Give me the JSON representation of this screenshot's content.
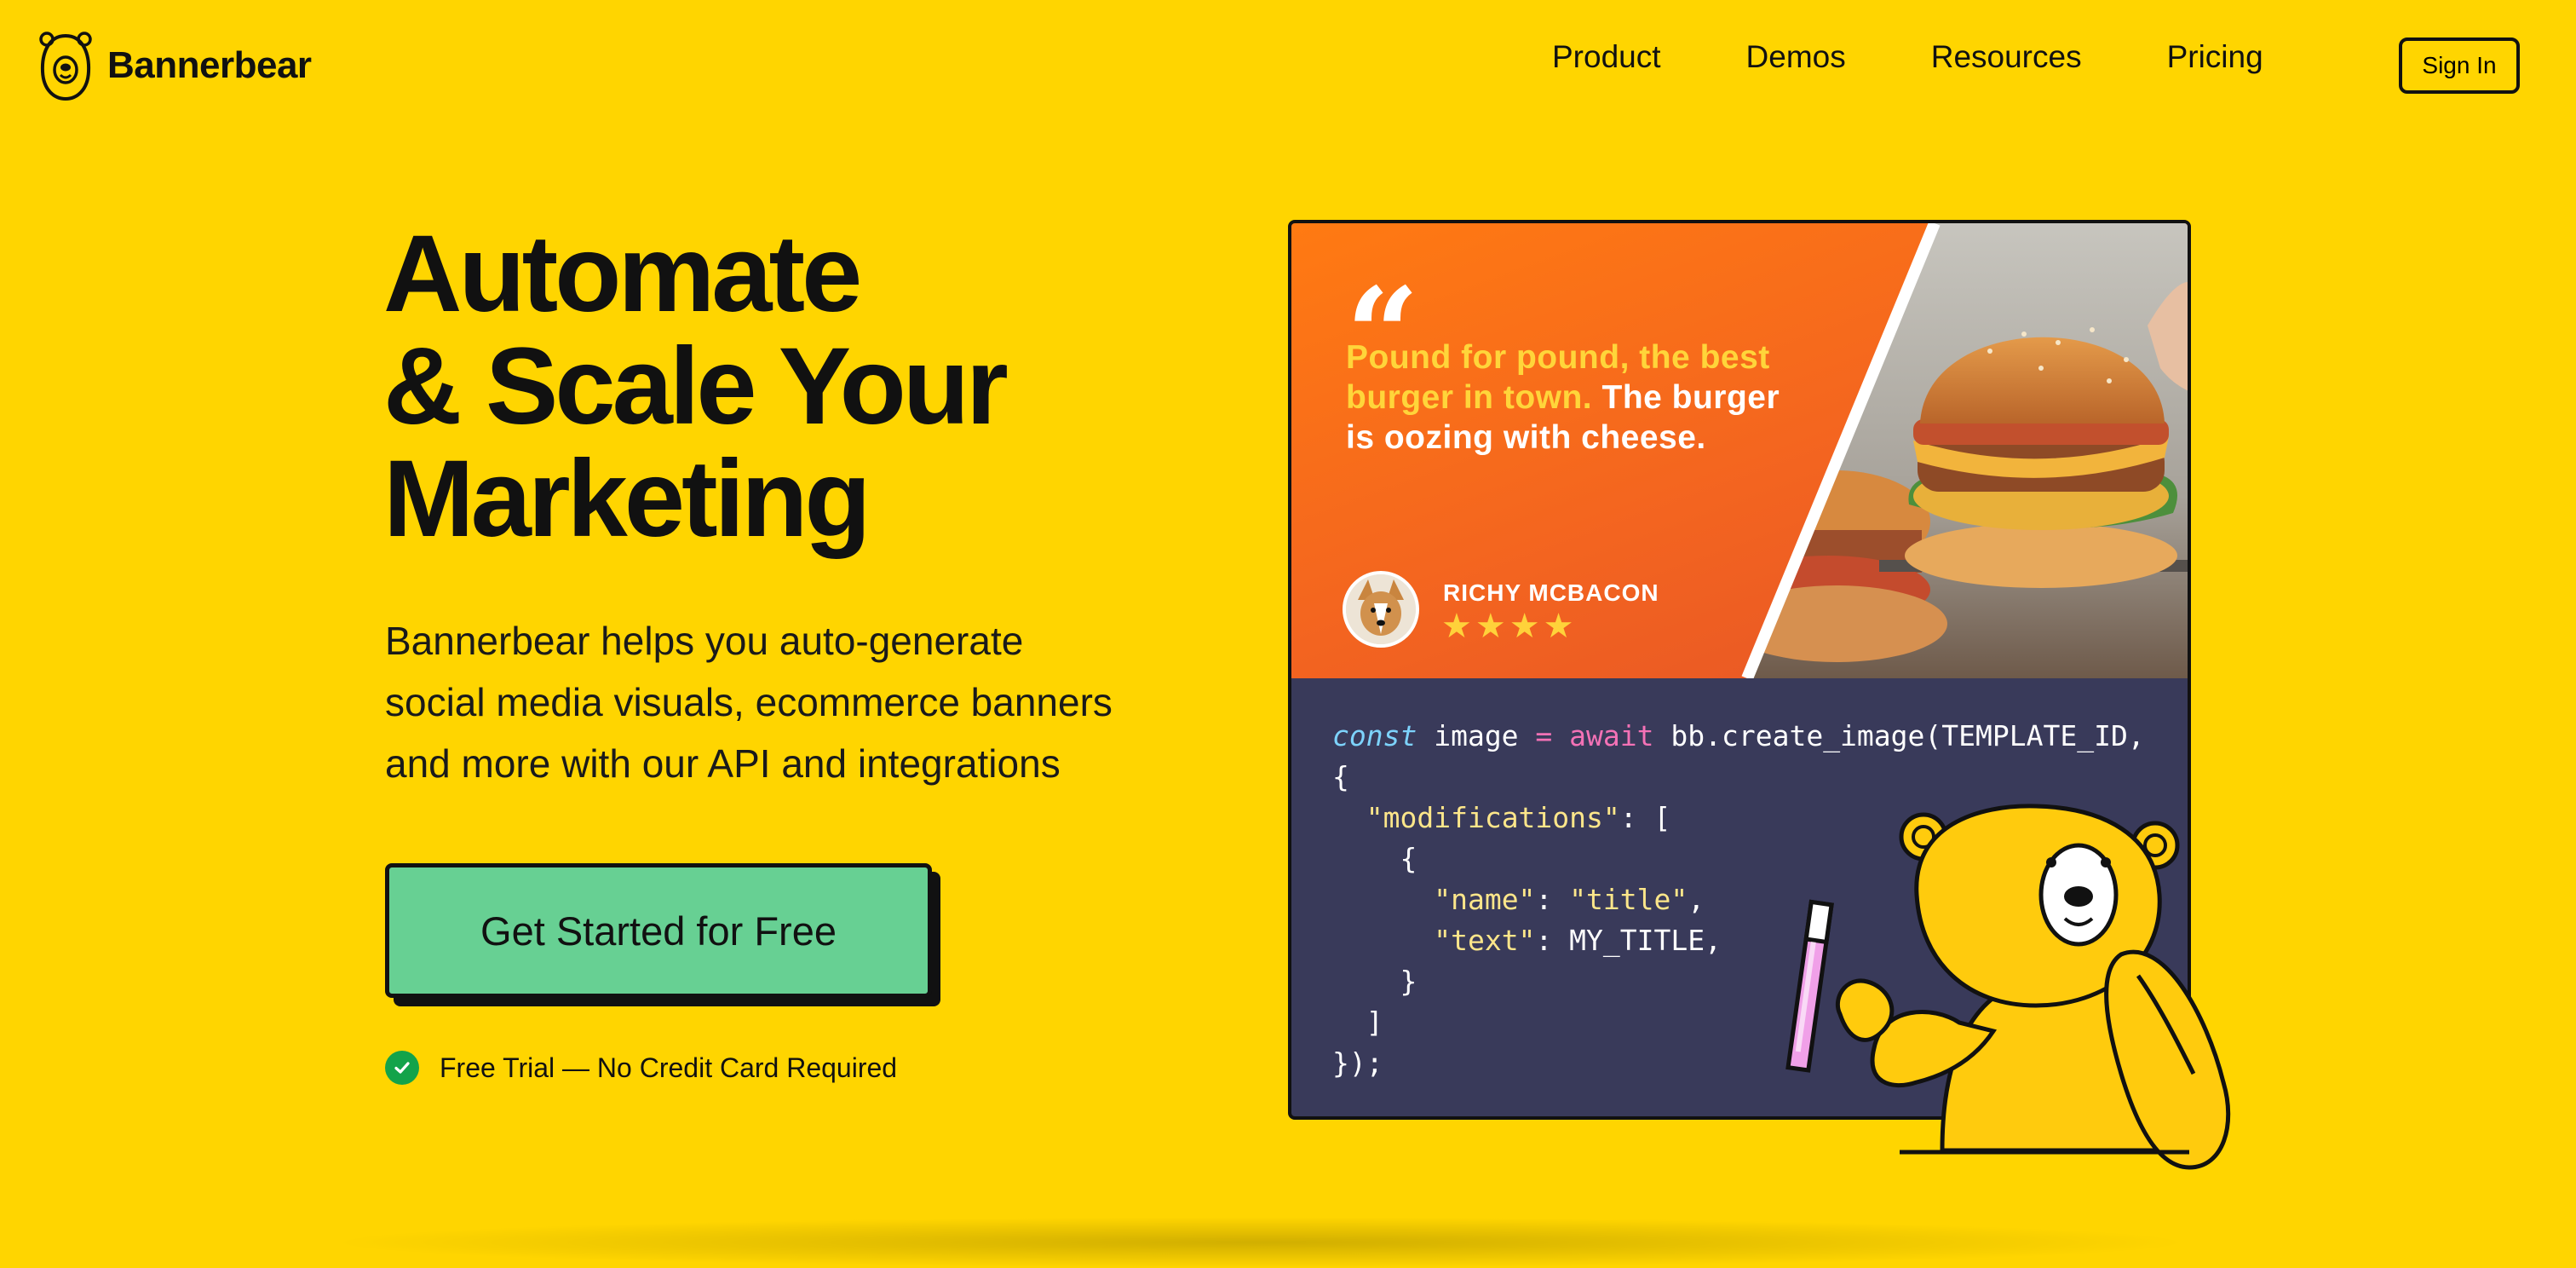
{
  "brand": {
    "name": "Bannerbear",
    "logo_icon": "bear-head-icon"
  },
  "nav": {
    "items": [
      "Product",
      "Demos",
      "Resources",
      "Pricing"
    ],
    "signin_label": "Sign In"
  },
  "hero": {
    "title_lines": [
      "Automate",
      "& Scale Your",
      "Marketing"
    ],
    "subtitle_lines": [
      "Bannerbear helps you auto-generate",
      "social media visuals, ecommerce banners",
      "and more with our API and integrations"
    ],
    "cta_label": "Get Started for Free",
    "trial_note": "Free Trial — No Credit Card Required"
  },
  "showcase": {
    "quote_mark": "“",
    "quote_highlight": "Pound for pound, the best burger in town.",
    "quote_rest": " The burger is oozing with cheese.",
    "reviewer": "RICHY MCBACON",
    "stars": "★★★★",
    "rating": 4
  },
  "code": {
    "line1": {
      "kw": "const",
      "mid": " image ",
      "op": "=",
      "sp": " ",
      "kw2": "await",
      "rest": " bb.create_image(TEMPLATE_ID,"
    },
    "line2": "{",
    "line3": {
      "indent": "  ",
      "str": "\"modifications\"",
      "rest": ": ["
    },
    "line4": "    {",
    "line5": {
      "indent": "      ",
      "str1": "\"name\"",
      "colon": ": ",
      "str2": "\"title\"",
      "end": ","
    },
    "line6": {
      "indent": "      ",
      "str": "\"text\"",
      "rest": ": MY_TITLE,"
    },
    "line7": "    }",
    "line8": "  ]",
    "line9": "});"
  },
  "colors": {
    "background": "#FFD500",
    "cta": "#67D093",
    "code_bg": "#393A5A",
    "promo": "#F36420",
    "highlight": "#FFD53A",
    "check": "#13A34A"
  }
}
